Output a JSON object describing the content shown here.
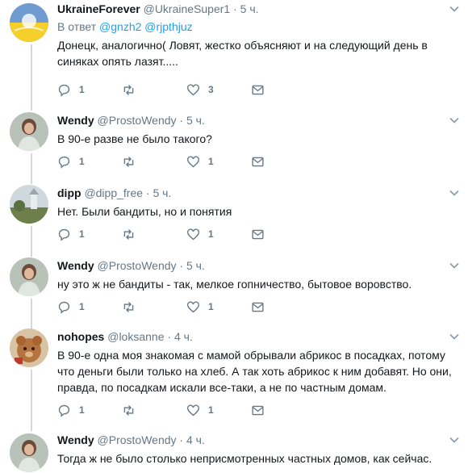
{
  "tweets": [
    {
      "name": "UkraineForever",
      "handle": "@UkraineSuper1",
      "time": "5 ч.",
      "reply_prefix": "В ответ",
      "mentions": [
        "@gnzh2",
        "@rjpthjuz"
      ],
      "text": "Донецк, аналогично( Ловят, жестко объясняют и на следующий день в синяках опять лазят.....",
      "reply_count": "1",
      "retweet_count": "",
      "like_count": "3"
    },
    {
      "name": "Wendy",
      "handle": "@ProstoWendy",
      "time": "5 ч.",
      "text": "В 90-е разве не было такого?",
      "reply_count": "1",
      "retweet_count": "",
      "like_count": "1"
    },
    {
      "name": "dipp",
      "handle": "@dipp_free",
      "time": "5 ч.",
      "text": "Нет. Были бандиты, но и понятия",
      "reply_count": "1",
      "retweet_count": "",
      "like_count": "1"
    },
    {
      "name": "Wendy",
      "handle": "@ProstoWendy",
      "time": "5 ч.",
      "text": "ну это ж не бандиты - так, мелкое гопничество, бытовое воровство.",
      "reply_count": "1",
      "retweet_count": "",
      "like_count": "1"
    },
    {
      "name": "nohopes",
      "handle": "@loksanne",
      "time": "4 ч.",
      "text": "В 90-е одна моя знакомая с мамой обрывали абрикос в посадках, потому что деньги были только на хлеб. А так хоть абрикос к ним добавят. Но они, правда, по посадкам искали все-таки, а не по частным домам.",
      "reply_count": "1",
      "retweet_count": "",
      "like_count": "1"
    },
    {
      "name": "Wendy",
      "handle": "@ProstoWendy",
      "time": "4 ч.",
      "text": "Тогда ж не было столько неприсмотренных частных домов, как сейчас.",
      "reply_count": "",
      "retweet_count": "",
      "like_count": ""
    }
  ],
  "separator": "·",
  "icons": [
    "reply-icon",
    "retweet-icon",
    "like-icon",
    "dm-icon",
    "chevron-down-icon"
  ],
  "colors": {
    "link": "#1da1f2",
    "muted": "#657786",
    "text": "#14171a",
    "line": "#cfd9de"
  }
}
